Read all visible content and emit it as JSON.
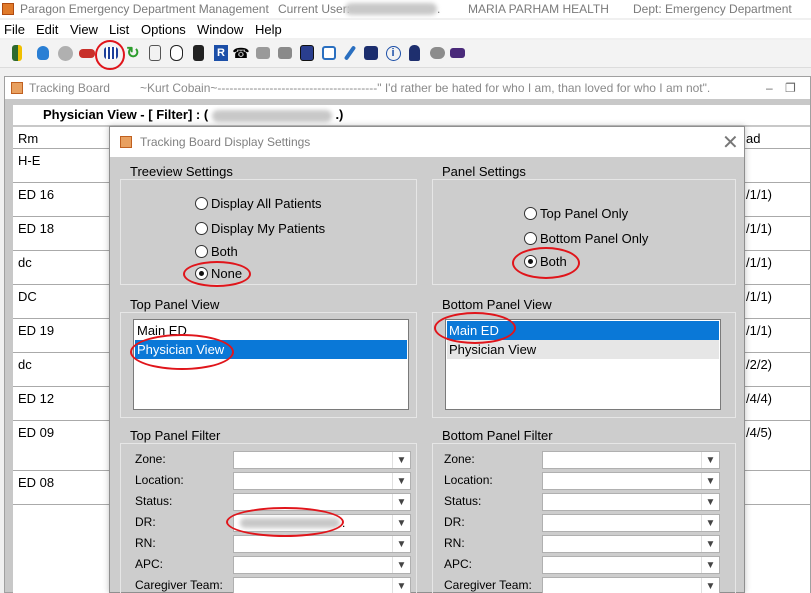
{
  "app": {
    "title": "Paragon Emergency Department Management",
    "current_user_label": "Current User:",
    "facility": "MARIA PARHAM HEALTH",
    "dept": "Dept:  Emergency Department"
  },
  "menu": [
    "File",
    "Edit",
    "View",
    "List",
    "Options",
    "Window",
    "Help"
  ],
  "toolbar_icons": [
    "exit-icon",
    "bottle-icon",
    "walking-icon",
    "car-icon",
    "grid-icon",
    "refresh-icon",
    "person-tag-icon",
    "face-icon",
    "id-card-icon",
    "r-icon",
    "phone-icon",
    "hand-icon",
    "hands-icon",
    "book-icon",
    "edit-icon",
    "pen-icon",
    "id-badge-icon",
    "info-icon",
    "doctor-icon",
    "chat-icon",
    "bed-icon"
  ],
  "tracking_window": {
    "title": "Tracking Board",
    "quote": "~Kurt Cobain~----------------------------------------\" I'd rather be hated for who I am, than loved for who I am not\".",
    "header": "Physician View -  [ Filter]  :  (",
    "header_end": ".)",
    "col_rm": "Rm",
    "col_end": "ad",
    "rows": [
      {
        "rm": "H-E",
        "right": ""
      },
      {
        "rm": "ED 16",
        "right": "/1/1)"
      },
      {
        "rm": "ED 18",
        "right": "/1/1)"
      },
      {
        "rm": "dc",
        "right": "/1/1)"
      },
      {
        "rm": "DC",
        "right": "/1/1)"
      },
      {
        "rm": "ED 19",
        "right": "/1/1)"
      },
      {
        "rm": "dc",
        "right": "/2/2)"
      },
      {
        "rm": "ED 12",
        "right": "/4/4)"
      },
      {
        "rm": "ED 09",
        "right": "/4/5)"
      },
      {
        "rm": "ED 08",
        "right": ""
      }
    ]
  },
  "dialog": {
    "title": "Tracking Board Display Settings",
    "treeview": {
      "label": "Treeview Settings",
      "options": [
        "Display All Patients",
        "Display My Patients",
        "Both",
        "None"
      ],
      "selected": "None"
    },
    "panel": {
      "label": "Panel Settings",
      "options": [
        "Top Panel Only",
        "Bottom Panel Only",
        "Both"
      ],
      "selected": "Both"
    },
    "top_view": {
      "label": "Top Panel View",
      "items": [
        "Main ED",
        "Physician View"
      ],
      "selected": "Physician View"
    },
    "bottom_view": {
      "label": "Bottom Panel View",
      "items": [
        "Main ED",
        "Physician View"
      ],
      "selected": "Main ED"
    },
    "top_filter": {
      "label": "Top Panel Filter",
      "fields": [
        "Zone:",
        "Location:",
        "Status:",
        "DR:",
        "RN:",
        "APC:",
        "Caregiver Team:"
      ],
      "dr_end": "."
    },
    "bottom_filter": {
      "label": "Bottom Panel Filter",
      "fields": [
        "Zone:",
        "Location:",
        "Status:",
        "DR:",
        "RN:",
        "APC:",
        "Caregiver Team:"
      ]
    }
  },
  "colors": {
    "selection": "#0a78d7",
    "annotation": "#e0151b"
  }
}
